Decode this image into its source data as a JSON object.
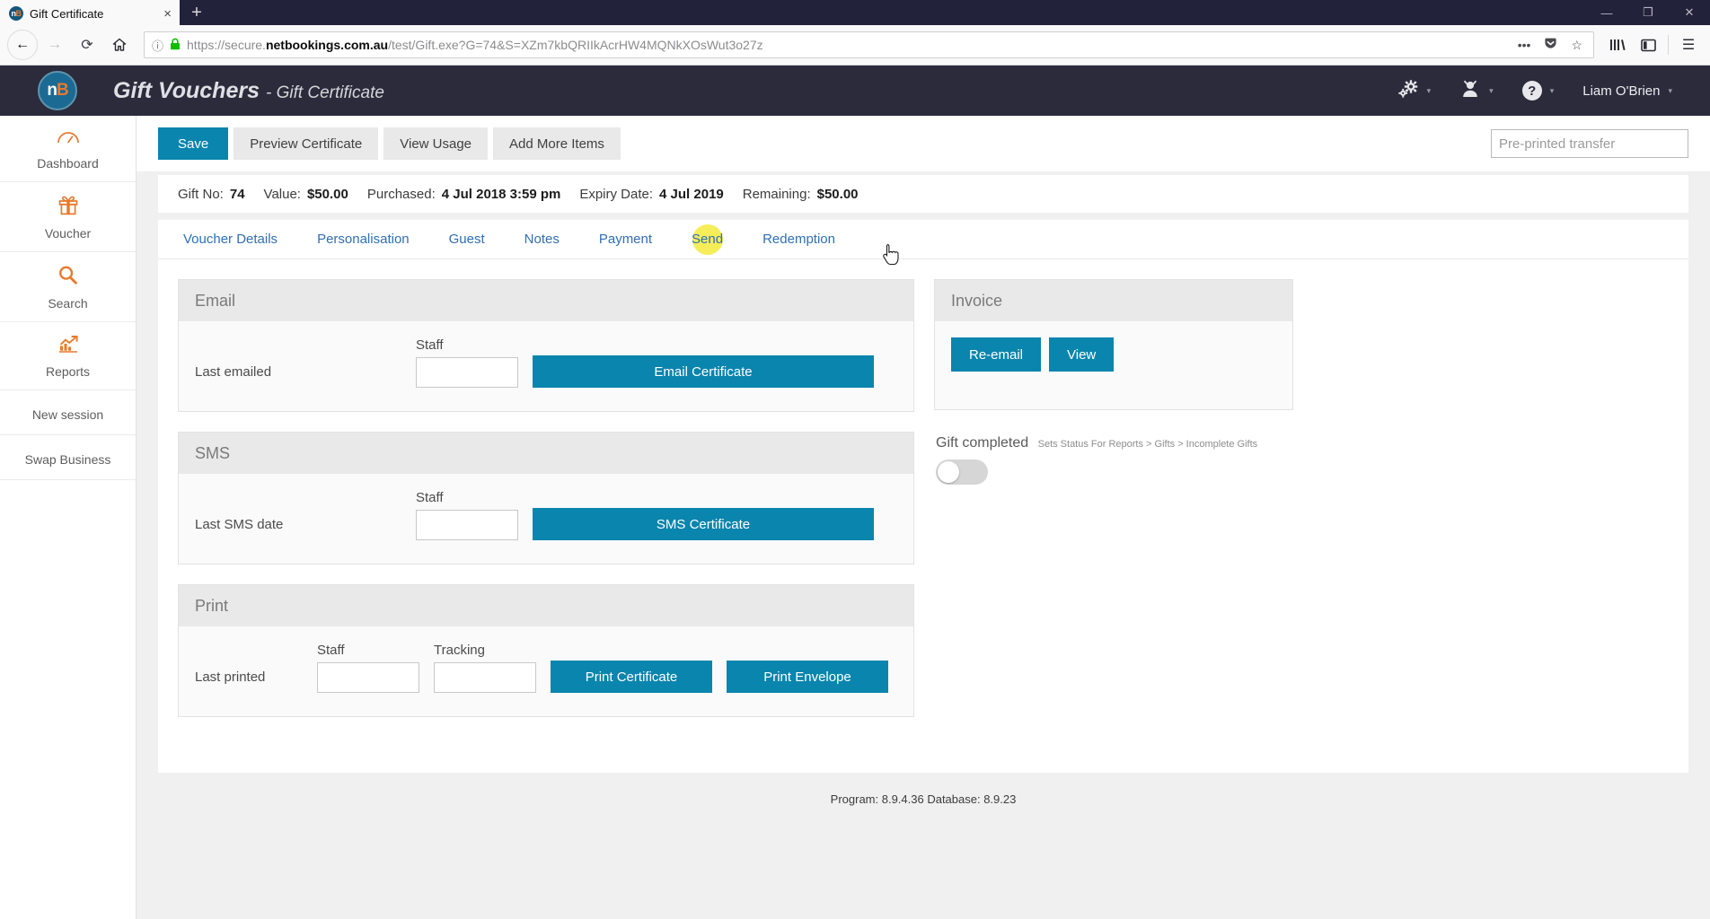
{
  "browser": {
    "tab_title": "Gift Certificate",
    "favicon_text": "n",
    "favicon_accent": "B",
    "new_tab_label": "+",
    "close_tab_label": "×",
    "window_controls": {
      "minimize": "—",
      "maximize": "❐",
      "close": "✕"
    },
    "url_prefix": "https://secure.",
    "url_domain": "netbookings.com.au",
    "url_path": "/test/Gift.exe?G=74&S=XZm7kbQRIIkAcrHW4MQNkXOsWut3o27z",
    "page_actions_label": "•••",
    "icons": {
      "back": "←",
      "forward": "→",
      "reload": "⟳",
      "home": "⌂",
      "info": "ⓘ",
      "lock": "🔒",
      "pocket": "▼",
      "bookmark": "☆",
      "library": "|||\\",
      "sidebar": "◫",
      "menu": "☰"
    }
  },
  "app_header": {
    "logo_text": "n",
    "logo_accent": "B",
    "title": "Gift Vouchers",
    "separator": "-",
    "subtitle": "Gift Certificate",
    "settings_icon": "⚙",
    "user_icon": "♟",
    "help_icon": "?",
    "username": "Liam O'Brien",
    "caret": "▾"
  },
  "sidebar": {
    "items": [
      {
        "icon": "⌿",
        "label": "Dashboard",
        "name": "dashboard"
      },
      {
        "icon": "🎁",
        "label": "Voucher",
        "name": "voucher"
      },
      {
        "icon": "🔍",
        "label": "Search",
        "name": "search"
      },
      {
        "icon": "📈",
        "label": "Reports",
        "name": "reports"
      },
      {
        "icon": "",
        "label": "New session",
        "name": "new-session"
      },
      {
        "icon": "",
        "label": "Swap Business",
        "name": "swap-business"
      }
    ]
  },
  "toolbar": {
    "save_label": "Save",
    "preview_label": "Preview Certificate",
    "view_usage_label": "View Usage",
    "add_items_label": "Add More Items",
    "preprinted_placeholder": "Pre-printed transfer",
    "preprinted_value": ""
  },
  "info_bar": {
    "gift_no_label": "Gift No:",
    "gift_no_value": "74",
    "value_label": "Value:",
    "value_value": "$50.00",
    "purchased_label": "Purchased:",
    "purchased_value": "4 Jul 2018 3:59 pm",
    "expiry_label": "Expiry Date:",
    "expiry_value": "4 Jul 2019",
    "remaining_label": "Remaining:",
    "remaining_value": "$50.00"
  },
  "tabs": [
    {
      "label": "Voucher Details",
      "name": "voucher-details",
      "highlight": false
    },
    {
      "label": "Personalisation",
      "name": "personalisation",
      "highlight": false
    },
    {
      "label": "Guest",
      "name": "guest",
      "highlight": false
    },
    {
      "label": "Notes",
      "name": "notes",
      "highlight": false
    },
    {
      "label": "Payment",
      "name": "payment",
      "highlight": false
    },
    {
      "label": "Send",
      "name": "send",
      "highlight": true
    },
    {
      "label": "Redemption",
      "name": "redemption",
      "highlight": false
    }
  ],
  "email_panel": {
    "title": "Email",
    "last_label": "Last emailed",
    "last_value": "",
    "staff_label": "Staff",
    "staff_value": "",
    "button_label": "Email Certificate"
  },
  "sms_panel": {
    "title": "SMS",
    "last_label": "Last SMS date",
    "last_value": "",
    "staff_label": "Staff",
    "staff_value": "",
    "button_label": "SMS Certificate"
  },
  "print_panel": {
    "title": "Print",
    "last_label": "Last printed",
    "last_value": "",
    "staff_label": "Staff",
    "staff_value": "",
    "tracking_label": "Tracking",
    "tracking_value": "",
    "print_certificate_label": "Print Certificate",
    "print_envelope_label": "Print Envelope"
  },
  "invoice_panel": {
    "title": "Invoice",
    "reemail_label": "Re-email",
    "view_label": "View"
  },
  "gift_completed": {
    "title": "Gift completed",
    "subtitle": "Sets Status For Reports > Gifts > Incomplete Gifts",
    "state": "off"
  },
  "footer": {
    "text": "Program: 8.9.4.36 Database: 8.9.23"
  },
  "colors": {
    "accent_blue": "#0a85ad",
    "brand_orange": "#e8792b",
    "header_dark": "#2b2b3c",
    "tab_link": "#2f6fb5",
    "highlight_yellow": "#f5ec4c"
  }
}
